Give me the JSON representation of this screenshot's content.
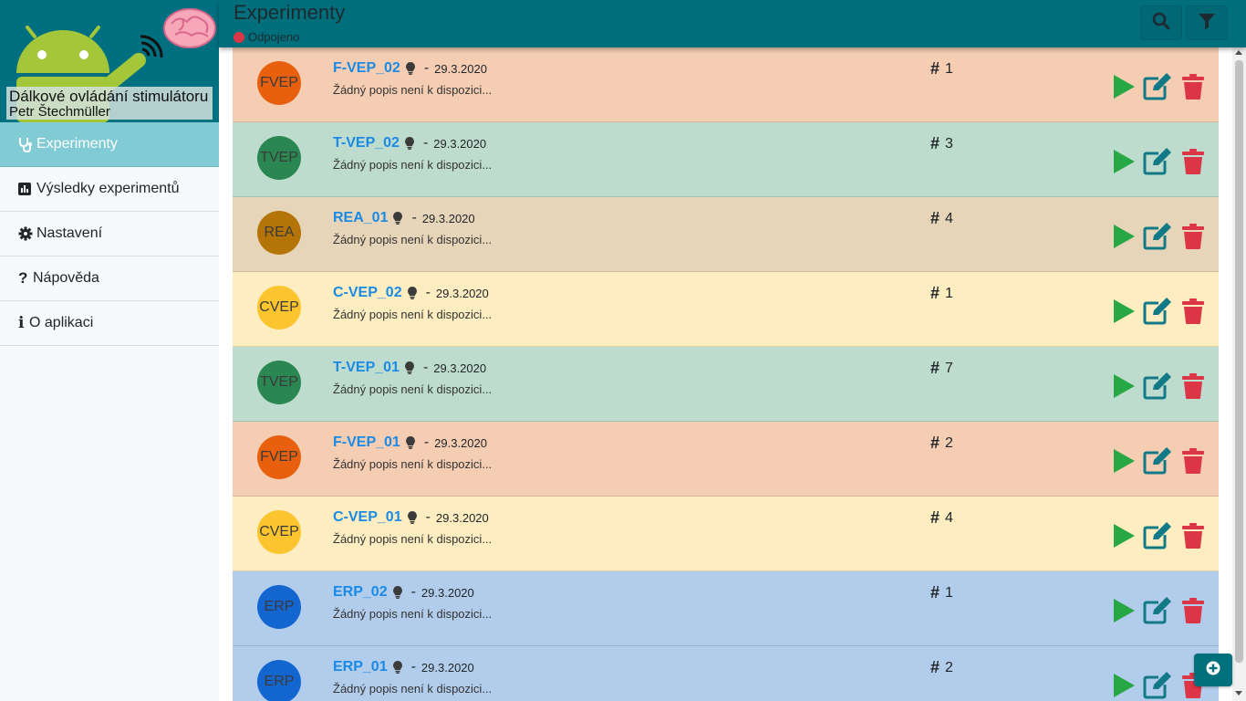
{
  "sidebar": {
    "app_title": "Dálkové ovládání stimulátoru",
    "user": "Petr Štechmüller",
    "items": [
      {
        "label": "Experimenty",
        "icon": "stethoscope-icon",
        "active": true
      },
      {
        "label": "Výsledky experimentů",
        "icon": "chart-icon",
        "active": false
      },
      {
        "label": "Nastavení",
        "icon": "gear-icon",
        "active": false
      },
      {
        "label": "Nápověda",
        "icon": "question-icon",
        "active": false
      },
      {
        "label": "O aplikaci",
        "icon": "info-icon",
        "active": false
      }
    ]
  },
  "topbar": {
    "title": "Experimenty",
    "status": "Odpojeno",
    "status_color": "#dc3545",
    "search_icon": "search-icon",
    "filter_icon": "filter-icon"
  },
  "colors": {
    "FVEP": {
      "row": "#f4cdb3",
      "avatar": "#e8600e"
    },
    "TVEP": {
      "row": "#bedccd",
      "avatar": "#2a8752"
    },
    "REA": {
      "row": "#e6d5b8",
      "avatar": "#b57408"
    },
    "CVEP": {
      "row": "#fdedc0",
      "avatar": "#fcc52f"
    },
    "ERP": {
      "row": "#b2cdec",
      "avatar": "#1366cf"
    },
    "play": "#28a745",
    "edit": "#117a86",
    "delete": "#dc3545",
    "link": "#1a8ae6"
  },
  "experiments": [
    {
      "type": "FVEP",
      "name": "F-VEP_02",
      "separator": "-",
      "date": "29.3.2020",
      "description": "Žádný popis není k dispozici...",
      "count": "1"
    },
    {
      "type": "TVEP",
      "name": "T-VEP_02",
      "separator": "-",
      "date": "29.3.2020",
      "description": "Žádný popis není k dispozici...",
      "count": "3"
    },
    {
      "type": "REA",
      "name": "REA_01",
      "separator": "-",
      "date": "29.3.2020",
      "description": "Žádný popis není k dispozici...",
      "count": "4"
    },
    {
      "type": "CVEP",
      "name": "C-VEP_02",
      "separator": "-",
      "date": "29.3.2020",
      "description": "Žádný popis není k dispozici...",
      "count": "1"
    },
    {
      "type": "TVEP",
      "name": "T-VEP_01",
      "separator": "-",
      "date": "29.3.2020",
      "description": "Žádný popis není k dispozici...",
      "count": "7"
    },
    {
      "type": "FVEP",
      "name": "F-VEP_01",
      "separator": "-",
      "date": "29.3.2020",
      "description": "Žádný popis není k dispozici...",
      "count": "2"
    },
    {
      "type": "CVEP",
      "name": "C-VEP_01",
      "separator": "-",
      "date": "29.3.2020",
      "description": "Žádný popis není k dispozici...",
      "count": "4"
    },
    {
      "type": "ERP",
      "name": "ERP_02",
      "separator": "-",
      "date": "29.3.2020",
      "description": "Žádný popis není k dispozici...",
      "count": "1"
    },
    {
      "type": "ERP",
      "name": "ERP_01",
      "separator": "-",
      "date": "29.3.2020",
      "description": "Žádný popis není k dispozici...",
      "count": "2"
    }
  ],
  "count_symbol": "#",
  "add_button_icon": "plus-circle-icon"
}
